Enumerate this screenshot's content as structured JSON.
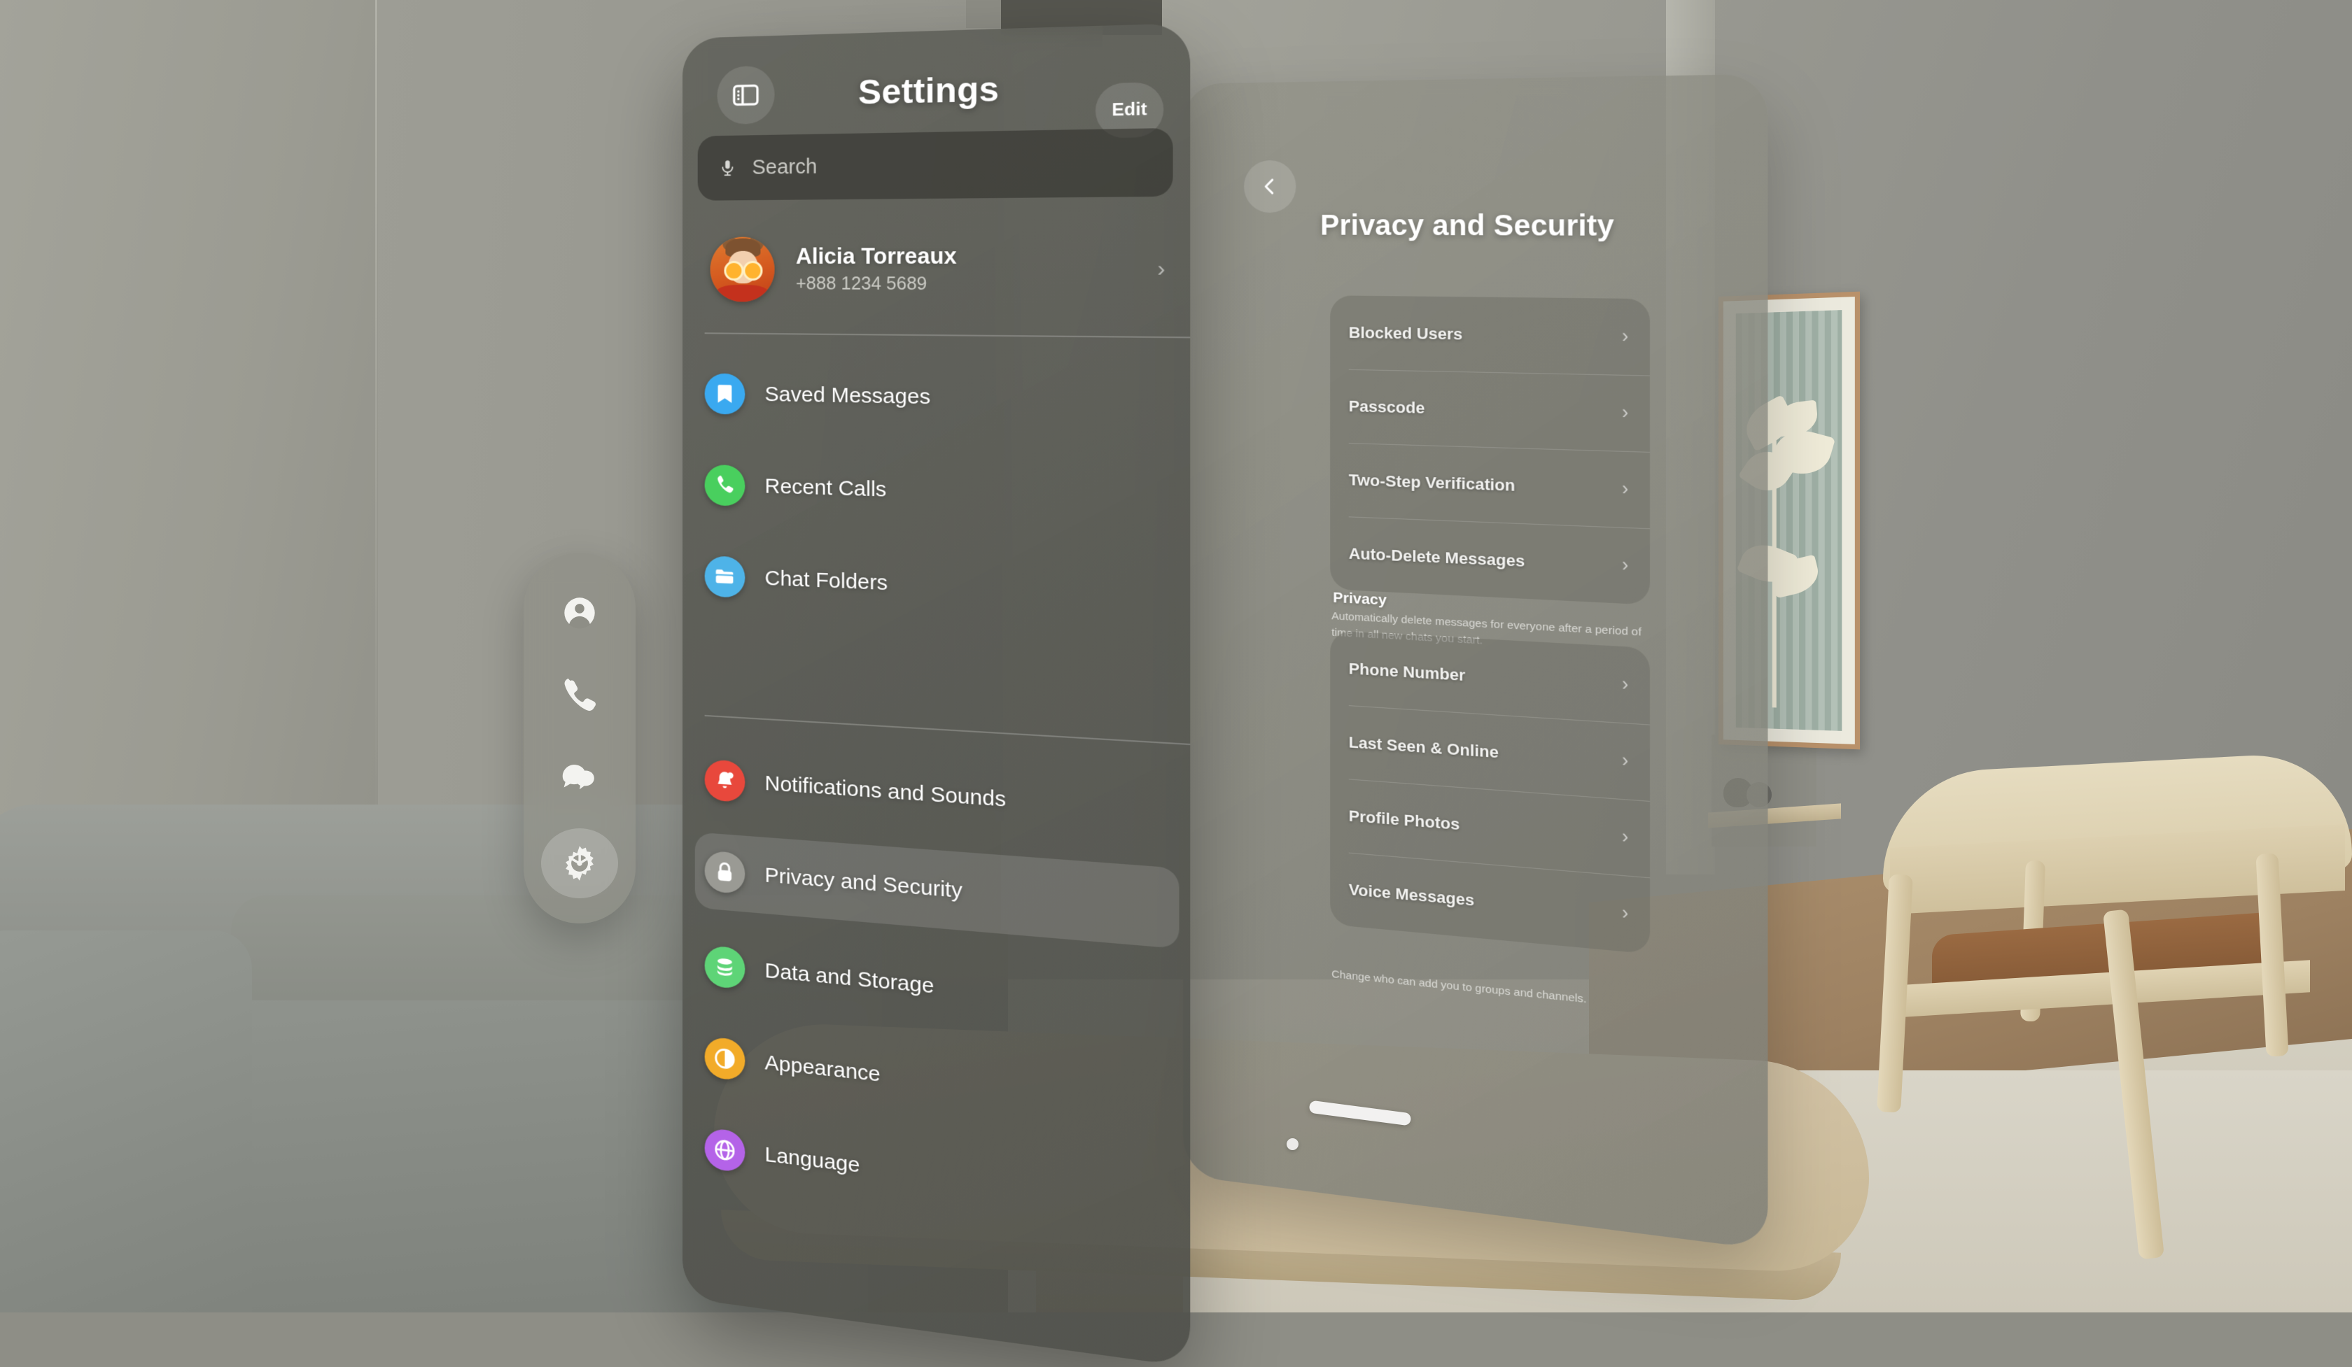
{
  "scene": {
    "environment": "living-room",
    "platform": "spatial-headset-passthrough"
  },
  "tabbar": {
    "items": [
      {
        "icon": "contacts-person-icon",
        "name": "contacts",
        "active": false
      },
      {
        "icon": "phone-handset-icon",
        "name": "calls",
        "active": false
      },
      {
        "icon": "chat-bubbles-icon",
        "name": "chats",
        "active": false
      },
      {
        "icon": "gear-icon",
        "name": "settings",
        "active": true
      }
    ]
  },
  "settings_panel": {
    "title": "Settings",
    "sidebar_toggle_icon": "sidebar-toggle-icon",
    "edit_label": "Edit",
    "search": {
      "placeholder": "Search",
      "icon": "microphone-icon"
    },
    "profile": {
      "name": "Alicia Torreaux",
      "phone": "+888 1234 5689",
      "avatar": "user-avatar-oranges",
      "chevron": "›"
    },
    "groups": [
      {
        "items": [
          {
            "label": "Saved Messages",
            "icon": "bookmark-icon",
            "color": "#3aa9f0"
          },
          {
            "label": "Recent Calls",
            "icon": "phone-handset-icon",
            "color": "#49cf5e"
          },
          {
            "label": "Chat Folders",
            "icon": "folder-icon",
            "color": "#4eb3e8"
          }
        ]
      },
      {
        "items": [
          {
            "label": "Notifications and Sounds",
            "icon": "bell-icon",
            "color": "#e8483c"
          },
          {
            "label": "Privacy and Security",
            "icon": "lock-icon",
            "color": "#9a9a94",
            "selected": true
          },
          {
            "label": "Data and Storage",
            "icon": "database-icon",
            "color": "#5ed477"
          },
          {
            "label": "Appearance",
            "icon": "contrast-circle-icon",
            "color": "#f2ab29"
          },
          {
            "label": "Language",
            "icon": "globe-icon",
            "color": "#b463e8",
            "partial": true
          }
        ]
      }
    ]
  },
  "detail_panel": {
    "back_icon": "chevron-left-icon",
    "title": "Privacy and Security",
    "sections": [
      {
        "header": "",
        "rows": [
          {
            "label": "Blocked Users",
            "chevron": "›"
          },
          {
            "label": "Passcode",
            "chevron": "›"
          },
          {
            "label": "Two-Step Verification",
            "chevron": "›"
          },
          {
            "label": "Auto-Delete Messages",
            "chevron": "›"
          }
        ],
        "footnote": "Automatically delete messages for everyone after a period of time in all new chats you start."
      },
      {
        "header": "Privacy",
        "rows": [
          {
            "label": "Phone Number",
            "chevron": "›"
          },
          {
            "label": "Last Seen & Online",
            "chevron": "›"
          },
          {
            "label": "Profile Photos",
            "chevron": "›"
          },
          {
            "label": "Voice Messages",
            "chevron": "›"
          }
        ],
        "footnote": "Change who can add you to groups and channels."
      }
    ]
  },
  "window_controls": {
    "grab_bar": "window-grab-bar",
    "close_dot": "window-close-dot"
  }
}
